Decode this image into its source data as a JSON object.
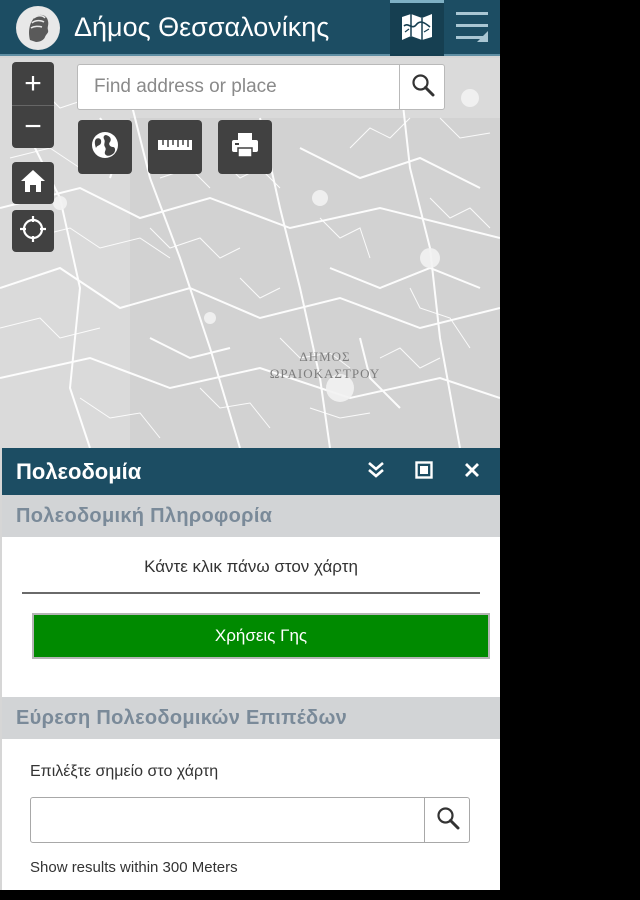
{
  "header": {
    "title": "Δήμος Θεσσαλονίκης",
    "logo_icon": "municipality-head-logo",
    "map_icon": "folded-map-icon",
    "menu_icon": "hamburger-menu-icon"
  },
  "map": {
    "label_line1": "ΔΗΜΟΣ",
    "label_line2": "ΩΡΑΙΟΚΑΣΤΡΟΥ",
    "zoom_in": "+",
    "zoom_out": "−",
    "search": {
      "placeholder": "Find address or place"
    },
    "tools": [
      "basemap-globe-icon",
      "scalebar-ruler-icon",
      "print-icon"
    ]
  },
  "panel": {
    "title": "Πολεοδομία",
    "section1": {
      "title": "Πολεοδομική Πληροφορία",
      "instruction": "Κάντε κλικ πάνω στον χάρτη",
      "button_label": "Χρήσεις Γης"
    },
    "section2": {
      "title": "Εύρεση Πολεοδομικών Επιπέδων",
      "instruction": "Επιλέξτε σημείο στο χάρτη",
      "search_value": "",
      "results_text": "Show results within 300 Meters"
    }
  },
  "colors": {
    "header_bg": "#1c4d63",
    "control_bg": "#414141",
    "accent_green": "#008a00",
    "section_bg": "#d2d4d6"
  }
}
